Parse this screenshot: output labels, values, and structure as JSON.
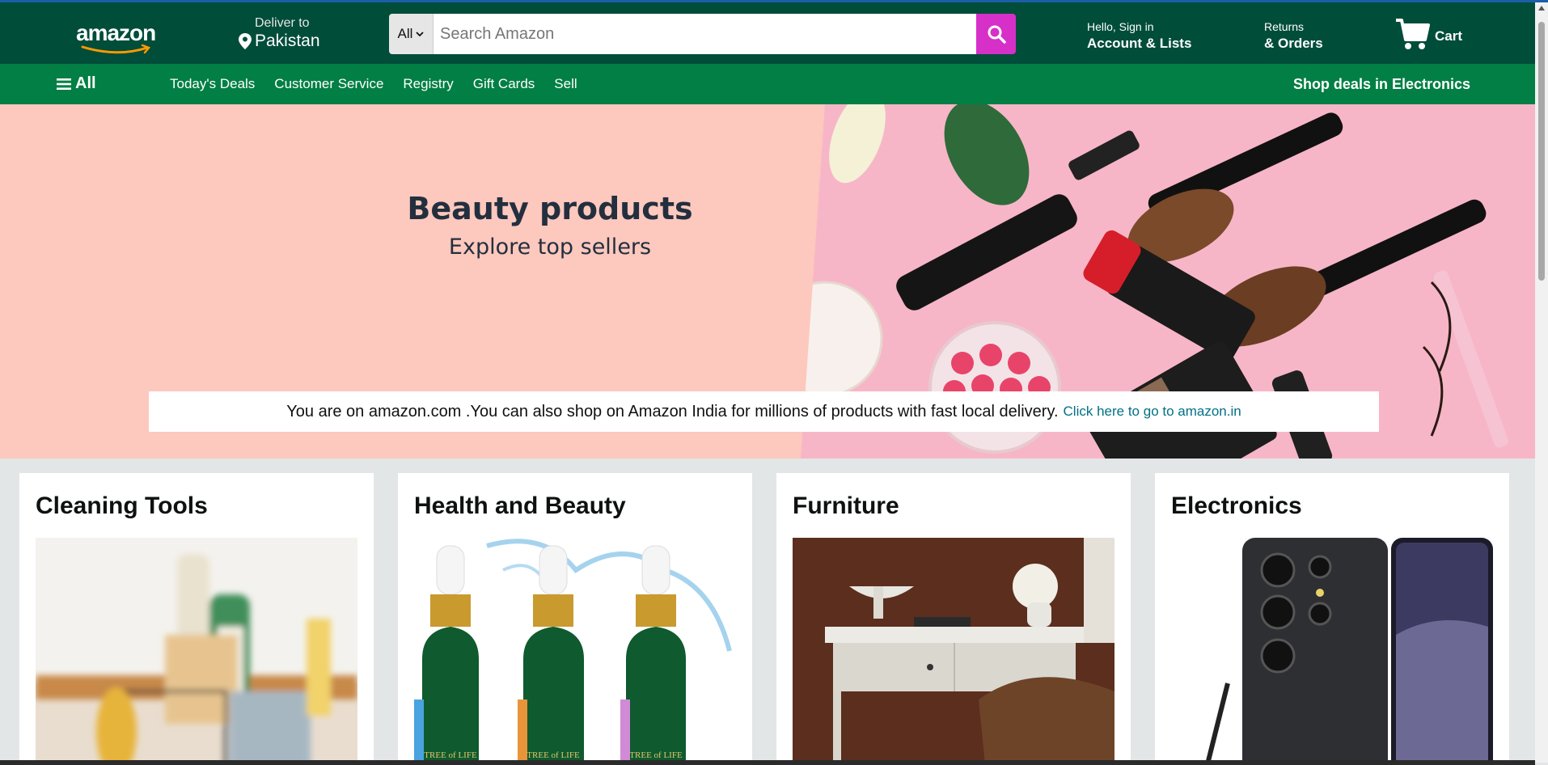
{
  "header": {
    "logo": "amazon",
    "deliver_line1": "Deliver to",
    "deliver_line2": "Pakistan",
    "search_category": "All",
    "search_placeholder": "Search Amazon",
    "account_line1": "Hello, Sign in",
    "account_line2": "Account & Lists",
    "returns_line1": "Returns",
    "returns_line2": "& Orders",
    "cart_label": "Cart"
  },
  "nav": {
    "all_label": "All",
    "links": [
      "Today's Deals",
      "Customer Service",
      "Registry",
      "Gift Cards",
      "Sell"
    ],
    "deals_label": "Shop deals in Electronics"
  },
  "hero": {
    "title": "Beauty products",
    "subtitle": "Explore top sellers",
    "notice_text": "You are on amazon.com .You can also shop on Amazon India for millions of products with fast local delivery.",
    "notice_link": "Click here to go to amazon.in"
  },
  "cards": [
    {
      "title": "Cleaning Tools"
    },
    {
      "title": "Health and Beauty",
      "product_text": "TREE of LIFE"
    },
    {
      "title": "Furniture"
    },
    {
      "title": "Electronics"
    }
  ],
  "colors": {
    "header_bg": "#004d3a",
    "nav_bg": "#027f44",
    "search_button": "#d630c9",
    "hero_bg": "#fdc8bd",
    "link": "#007185"
  },
  "icons": [
    "location-pin-icon",
    "chevron-down-icon",
    "search-icon",
    "cart-icon",
    "hamburger-menu-icon"
  ]
}
